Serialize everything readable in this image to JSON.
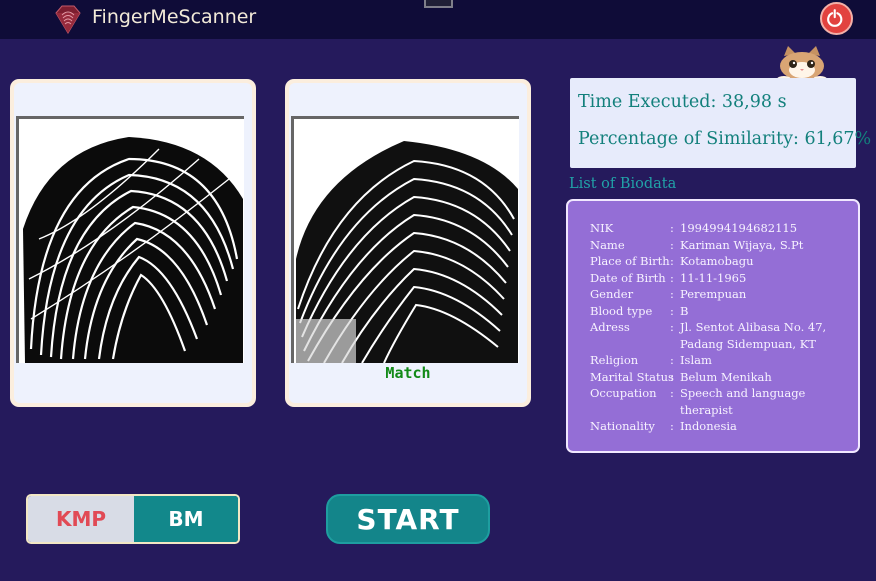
{
  "app": {
    "title": "FingerMeScanner",
    "logo_icon": "diamond-fingerprint-icon",
    "power_icon": "power-icon"
  },
  "input_panel": {
    "image_description": "fingerprint-image"
  },
  "result_panel": {
    "image_description": "fingerprint-image",
    "status": "Match",
    "status_color": "#128a18"
  },
  "mascot_icon": "cat-icon",
  "results": {
    "time_executed": "Time Executed: 38,98 s",
    "similarity": "Percentage of Similarity: 61,67%"
  },
  "biodata": {
    "title": "List of Biodata",
    "rows": [
      {
        "key": "NIK",
        "value": "1994994194682115"
      },
      {
        "key": "Name",
        "value": "Kariman Wijaya, S.Pt"
      },
      {
        "key": "Place of Birth",
        "value": "Kotamobagu"
      },
      {
        "key": "Date of Birth",
        "value": "11-11-1965"
      },
      {
        "key": "Gender",
        "value": "Perempuan"
      },
      {
        "key": "Blood type",
        "value": "B"
      },
      {
        "key": "Adress",
        "value": "Jl. Sentot Alibasa No. 47, Padang Sidempuan, KT"
      },
      {
        "key": "Religion",
        "value": "Islam"
      },
      {
        "key": "Marital Status",
        "value": "Belum Menikah"
      },
      {
        "key": "Occupation",
        "value": "Speech and language therapist"
      },
      {
        "key": "Nationality",
        "value": "Indonesia"
      }
    ]
  },
  "algorithm_toggle": {
    "options": [
      "KMP",
      "BM"
    ],
    "selected": "BM"
  },
  "start_button": "START",
  "colors": {
    "background": "#251a5c",
    "topbar": "#0f0c38",
    "accent_teal": "#13858a",
    "biodata_bg": "#946ed6",
    "kmp_text": "#e14a55"
  }
}
